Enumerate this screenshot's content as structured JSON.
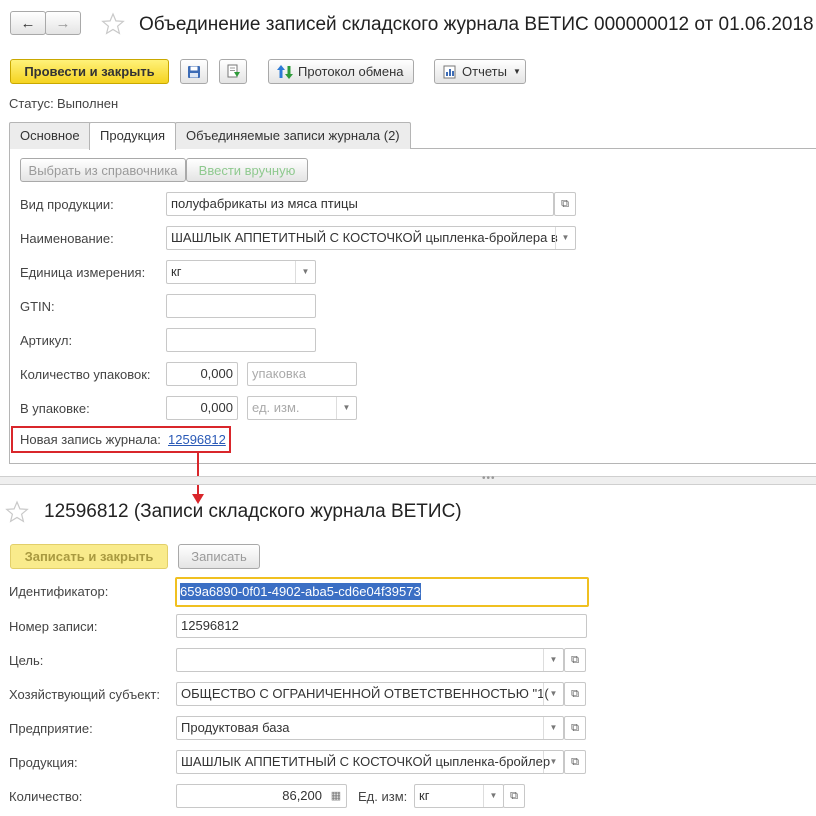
{
  "top_form": {
    "title": "Объединение записей складского журнала ВЕТИС 000000012 от 01.06.2018",
    "nav_back": "←",
    "nav_forward": "→",
    "favorite_icon": "star-icon",
    "toolbar": {
      "post_close": "Провести и закрыть",
      "save_icon": "floppy-icon",
      "post_icon": "post-document-icon",
      "exchange_log": "Протокол обмена",
      "reports": "Отчеты"
    },
    "status_label": "Статус:",
    "status_value": "Выполнен",
    "tabs": [
      "Основное",
      "Продукция",
      "Объединяемые записи журнала (2)"
    ],
    "product_tab": {
      "choose_from_catalog": "Выбрать из справочника",
      "enter_manually": "Ввести вручную",
      "fields": {
        "product_type_label": "Вид продукции:",
        "product_type_value": "полуфабрикаты из мяса птицы",
        "name_label": "Наименование:",
        "name_value": "ШАШЛЫК АППЕТИТНЫЙ С КОСТОЧКОЙ цыпленка-бройлера в",
        "unit_label": "Единица измерения:",
        "unit_value": "кг",
        "gtin_label": "GTIN:",
        "gtin_value": "",
        "article_label": "Артикул:",
        "article_value": "",
        "packages_label": "Количество упаковок:",
        "packages_value": "0,000",
        "packages_placeholder": "упаковка",
        "in_package_label": "В упаковке:",
        "in_package_value": "0,000",
        "in_package_placeholder": "ед. изм."
      },
      "new_record_label": "Новая запись журнала:",
      "new_record_link": "12596812"
    }
  },
  "bottom_form": {
    "title": "12596812 (Записи складского журнала ВЕТИС)",
    "favorite_icon": "star-icon",
    "write_close": "Записать и закрыть",
    "write": "Записать",
    "fields": {
      "id_label": "Идентификатор:",
      "id_value": "659a6890-0f01-4902-aba5-cd6e04f39573",
      "record_no_label": "Номер записи:",
      "record_no_value": "12596812",
      "goal_label": "Цель:",
      "goal_value": "",
      "entity_label": "Хозяйствующий субъект:",
      "entity_value": "ОБЩЕСТВО С ОГРАНИЧЕННОЙ ОТВЕТСТВЕННОСТЬЮ \"1(",
      "enterprise_label": "Предприятие:",
      "enterprise_value": "Продуктовая база",
      "product_label": "Продукция:",
      "product_value": "ШАШЛЫК АППЕТИТНЫЙ С КОСТОЧКОЙ цыпленка-бройлер",
      "quantity_label": "Количество:",
      "quantity_value": "86,200",
      "unit_label": "Ед. изм:",
      "unit_value": "кг"
    }
  },
  "colors": {
    "accent_yellow": "#f5d321",
    "highlight_red": "#d9262b",
    "link_blue": "#2a5ab7",
    "focus_border": "#f0c020",
    "selection_bg": "#3b6fc4"
  }
}
